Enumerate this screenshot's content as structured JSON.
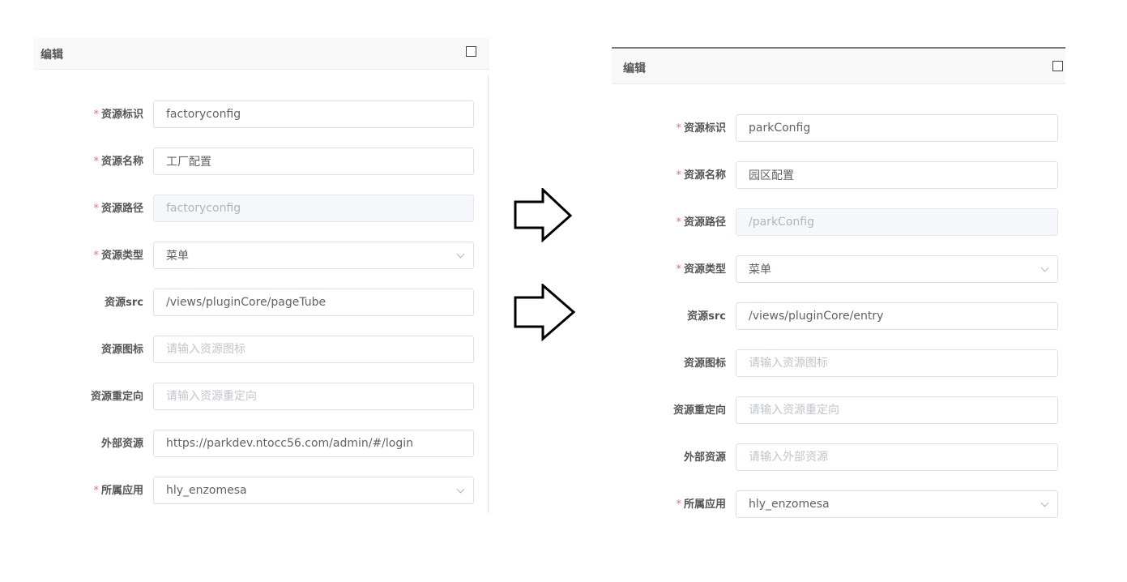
{
  "left_panel": {
    "title": "编辑",
    "fields": [
      {
        "label": "资源标识",
        "required": true,
        "value": "factoryconfig",
        "placeholder": "",
        "kind": "text"
      },
      {
        "label": "资源名称",
        "required": true,
        "value": "工厂配置",
        "placeholder": "",
        "kind": "text"
      },
      {
        "label": "资源路径",
        "required": true,
        "value": "factoryconfig",
        "placeholder": "",
        "kind": "disabled"
      },
      {
        "label": "资源类型",
        "required": true,
        "value": "菜单",
        "placeholder": "",
        "kind": "select"
      },
      {
        "label": "资源src",
        "required": false,
        "value": "/views/pluginCore/pageTube",
        "placeholder": "",
        "kind": "text"
      },
      {
        "label": "资源图标",
        "required": false,
        "value": "",
        "placeholder": "请输入资源图标",
        "kind": "text"
      },
      {
        "label": "资源重定向",
        "required": false,
        "value": "",
        "placeholder": "请输入资源重定向",
        "kind": "text"
      },
      {
        "label": "外部资源",
        "required": false,
        "value": "https://parkdev.ntocc56.com/admin/#/login",
        "placeholder": "",
        "kind": "text"
      },
      {
        "label": "所属应用",
        "required": true,
        "value": "hly_enzomesa",
        "placeholder": "",
        "kind": "select"
      }
    ]
  },
  "right_panel": {
    "title": "编辑",
    "fields": [
      {
        "label": "资源标识",
        "required": true,
        "value": "parkConfig",
        "placeholder": "",
        "kind": "text"
      },
      {
        "label": "资源名称",
        "required": true,
        "value": "园区配置",
        "placeholder": "",
        "kind": "text"
      },
      {
        "label": "资源路径",
        "required": true,
        "value": "/parkConfig",
        "placeholder": "",
        "kind": "disabled"
      },
      {
        "label": "资源类型",
        "required": true,
        "value": "菜单",
        "placeholder": "",
        "kind": "select"
      },
      {
        "label": "资源src",
        "required": false,
        "value": "/views/pluginCore/entry",
        "placeholder": "",
        "kind": "text"
      },
      {
        "label": "资源图标",
        "required": false,
        "value": "",
        "placeholder": "请输入资源图标",
        "kind": "text"
      },
      {
        "label": "资源重定向",
        "required": false,
        "value": "",
        "placeholder": "请输入资源重定向",
        "kind": "text"
      },
      {
        "label": "外部资源",
        "required": false,
        "value": "",
        "placeholder": "请输入外部资源",
        "kind": "text"
      },
      {
        "label": "所属应用",
        "required": true,
        "value": "hly_enzomesa",
        "placeholder": "",
        "kind": "select"
      }
    ]
  },
  "icons": {
    "maximize": "maximize-icon",
    "arrow": "right-arrow-icon",
    "chevron": "chevron-down-icon"
  },
  "colors": {
    "required_star": "#f56c6c",
    "header_bg": "#f8f8f8",
    "border": "#dcdfe6",
    "disabled_bg": "#f5f7fa",
    "placeholder": "#c0c4cc"
  }
}
